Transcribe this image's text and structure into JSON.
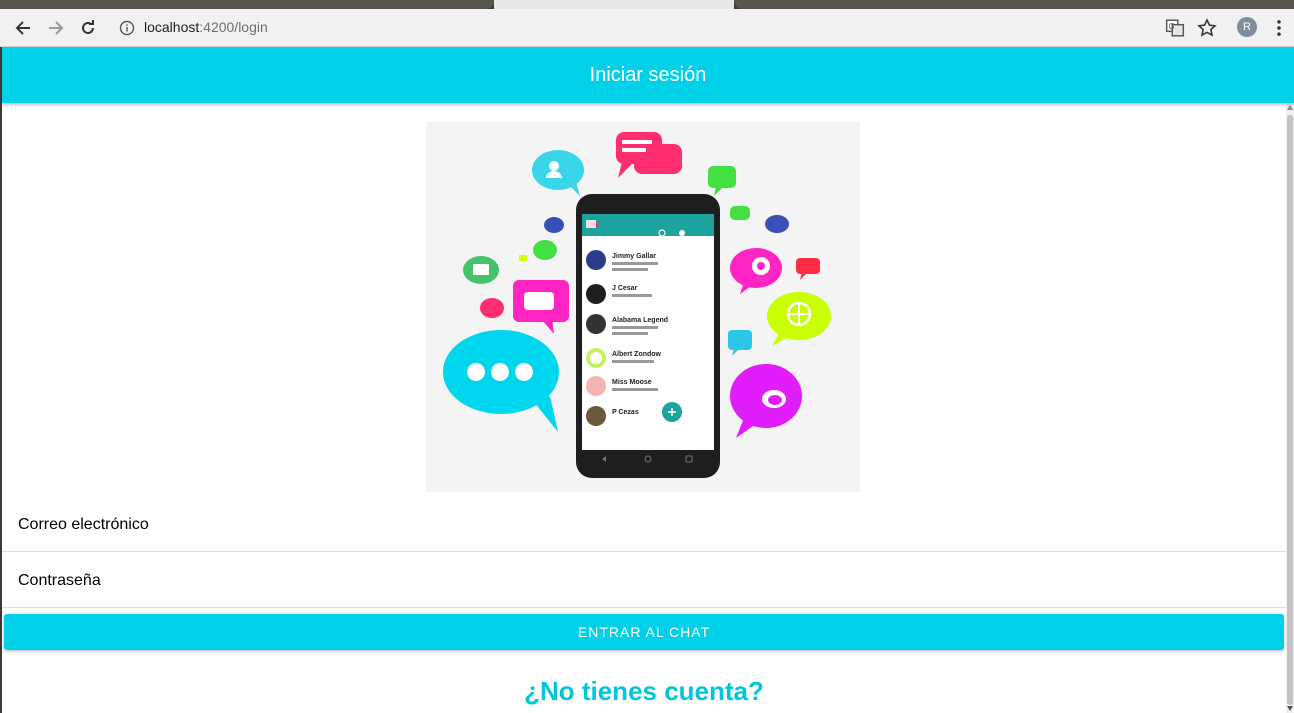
{
  "browser": {
    "url_host": "localhost",
    "url_path": ":4200/login",
    "profile_initial": "R",
    "icons": [
      "back-arrow-icon",
      "forward-arrow-icon",
      "reload-icon",
      "site-info-icon",
      "translate-icon",
      "bookmark-star-icon",
      "more-vert-icon"
    ]
  },
  "appbar": {
    "title": "Iniciar sesión"
  },
  "form": {
    "email_placeholder": "Correo electrónico",
    "password_placeholder": "Contraseña",
    "submit_label": "ENTRAR AL CHAT"
  },
  "footer": {
    "signup_question": "¿No tienes cuenta?"
  },
  "hero_image": {
    "chat_list": [
      "Jimmy Gallar",
      "J Cesar",
      "Alabama Legend",
      "Albert Zondow",
      "Miss Moose",
      "P Cezas"
    ]
  },
  "colors": {
    "accent": "#00d1e9",
    "link": "#00c6db"
  }
}
